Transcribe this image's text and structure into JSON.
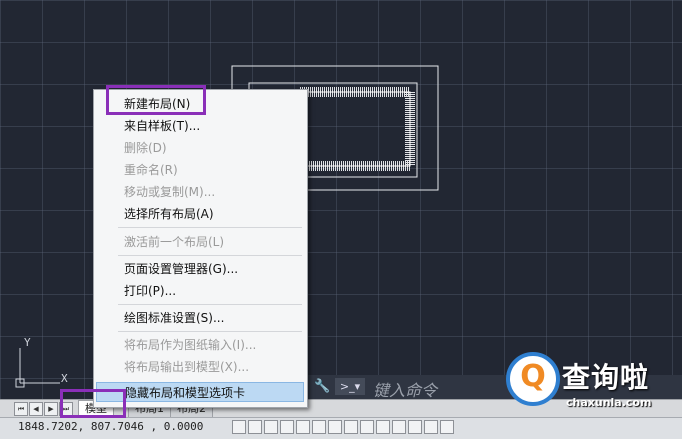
{
  "context_menu": {
    "items": [
      {
        "label": "新建布局(N)",
        "enabled": true
      },
      {
        "label": "来自样板(T)...",
        "enabled": true
      },
      {
        "label": "删除(D)",
        "enabled": false
      },
      {
        "label": "重命名(R)",
        "enabled": false
      },
      {
        "label": "移动或复制(M)...",
        "enabled": false
      },
      {
        "label": "选择所有布局(A)",
        "enabled": true
      },
      {
        "label": "激活前一个布局(L)",
        "enabled": false
      },
      {
        "label": "页面设置管理器(G)...",
        "enabled": true
      },
      {
        "label": "打印(P)...",
        "enabled": true
      },
      {
        "label": "绘图标准设置(S)...",
        "enabled": true
      },
      {
        "label": "将布局作为图纸输入(I)...",
        "enabled": false
      },
      {
        "label": "将布局输出到模型(X)...",
        "enabled": false
      },
      {
        "label": "隐藏布局和模型选项卡",
        "enabled": true
      }
    ]
  },
  "command_line": {
    "prompt_icon": "command-prompt-icon",
    "placeholder": "键入命令"
  },
  "tabs": {
    "model": "模型",
    "layout1": "布局1",
    "layout2": "布局2"
  },
  "status_bar": {
    "coordinates": "1848.7202, 807.7046 , 0.0000"
  },
  "ucs": {
    "x_label": "X",
    "y_label": "Y"
  },
  "watermark": {
    "title": "查询啦",
    "subtitle": "chaxunla.com"
  },
  "colors": {
    "highlight": "#8a2fb8",
    "menu_hover": "#bcd9f3",
    "canvas": "#222733",
    "watermark_ring": "#2f7fd0",
    "watermark_q": "#f08a24"
  }
}
